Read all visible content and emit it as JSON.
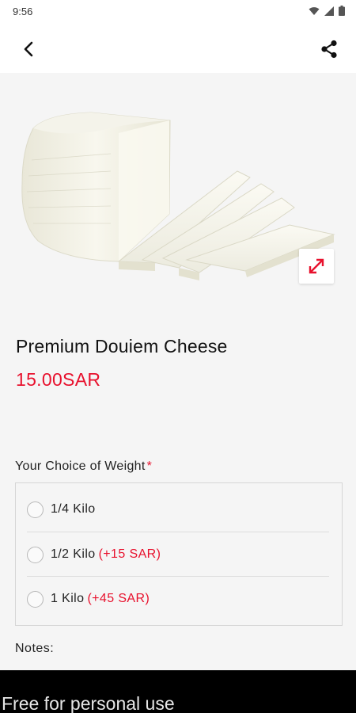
{
  "status_bar": {
    "time": "9:56",
    "icons": [
      "wifi-icon",
      "signal-icon",
      "battery-icon"
    ]
  },
  "app_bar": {
    "back_icon": "chevron-left-icon",
    "share_icon": "share-icon"
  },
  "hero": {
    "image": "cheese-product-image",
    "expand_icon": "expand-icon"
  },
  "product": {
    "title": "Premium Douiem Cheese",
    "price": "15.00SAR"
  },
  "weight": {
    "label": "Your Choice of Weight",
    "required_mark": "*",
    "options": [
      {
        "label": "1/4 Kilo",
        "extra": ""
      },
      {
        "label": "1/2 Kilo",
        "extra": "(+15 SAR)"
      },
      {
        "label": "1 Kilo",
        "extra": "(+45 SAR)"
      }
    ]
  },
  "notes": {
    "label": "Notes:"
  },
  "watermark": {
    "text": "Free for personal use"
  },
  "colors": {
    "accent": "#e8112d",
    "background": "#f5f5f5",
    "app_bar": "#ffffff"
  }
}
